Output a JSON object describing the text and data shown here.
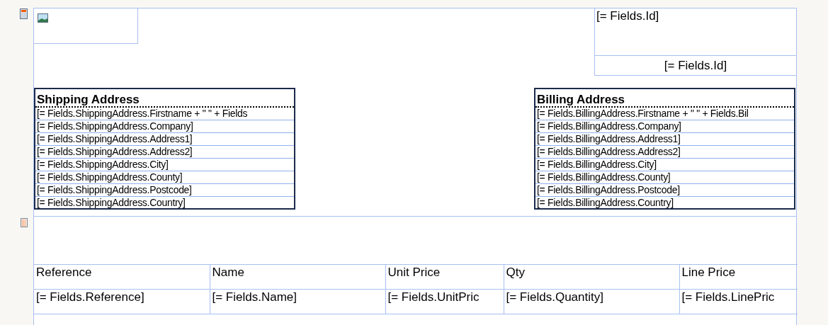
{
  "header": {
    "id_fields": [
      "[= Fields.Id]",
      "[= Fields.Id]"
    ],
    "addresses": [
      {
        "title": "Shipping Address",
        "lines": [
          "[= Fields.ShippingAddress.Firstname + \" \" + Fields",
          "[= Fields.ShippingAddress.Company]",
          "[= Fields.ShippingAddress.Address1]",
          "[= Fields.ShippingAddress.Address2]",
          "[= Fields.ShippingAddress.City]",
          "[= Fields.ShippingAddress.County]",
          "[= Fields.ShippingAddress.Postcode]",
          "[= Fields.ShippingAddress.Country]"
        ]
      },
      {
        "title": "Billing Address",
        "lines": [
          "[= Fields.BillingAddress.Firstname + \" \" + Fields.Bil",
          "[= Fields.BillingAddress.Company]",
          "[= Fields.BillingAddress.Address1]",
          "[= Fields.BillingAddress.Address2]",
          "[= Fields.BillingAddress.City]",
          "[= Fields.BillingAddress.County]",
          "[= Fields.BillingAddress.Postcode]",
          "[= Fields.BillingAddress.Country]"
        ]
      }
    ]
  },
  "table": {
    "columns": [
      "Reference",
      "Name",
      "Unit Price",
      "Qty",
      "Line Price"
    ],
    "rows": [
      [
        "[= Fields.Reference]",
        "[= Fields.Name]",
        "[= Fields.UnitPric",
        "[= Fields.Quantity]",
        "[= Fields.LinePric"
      ]
    ]
  }
}
